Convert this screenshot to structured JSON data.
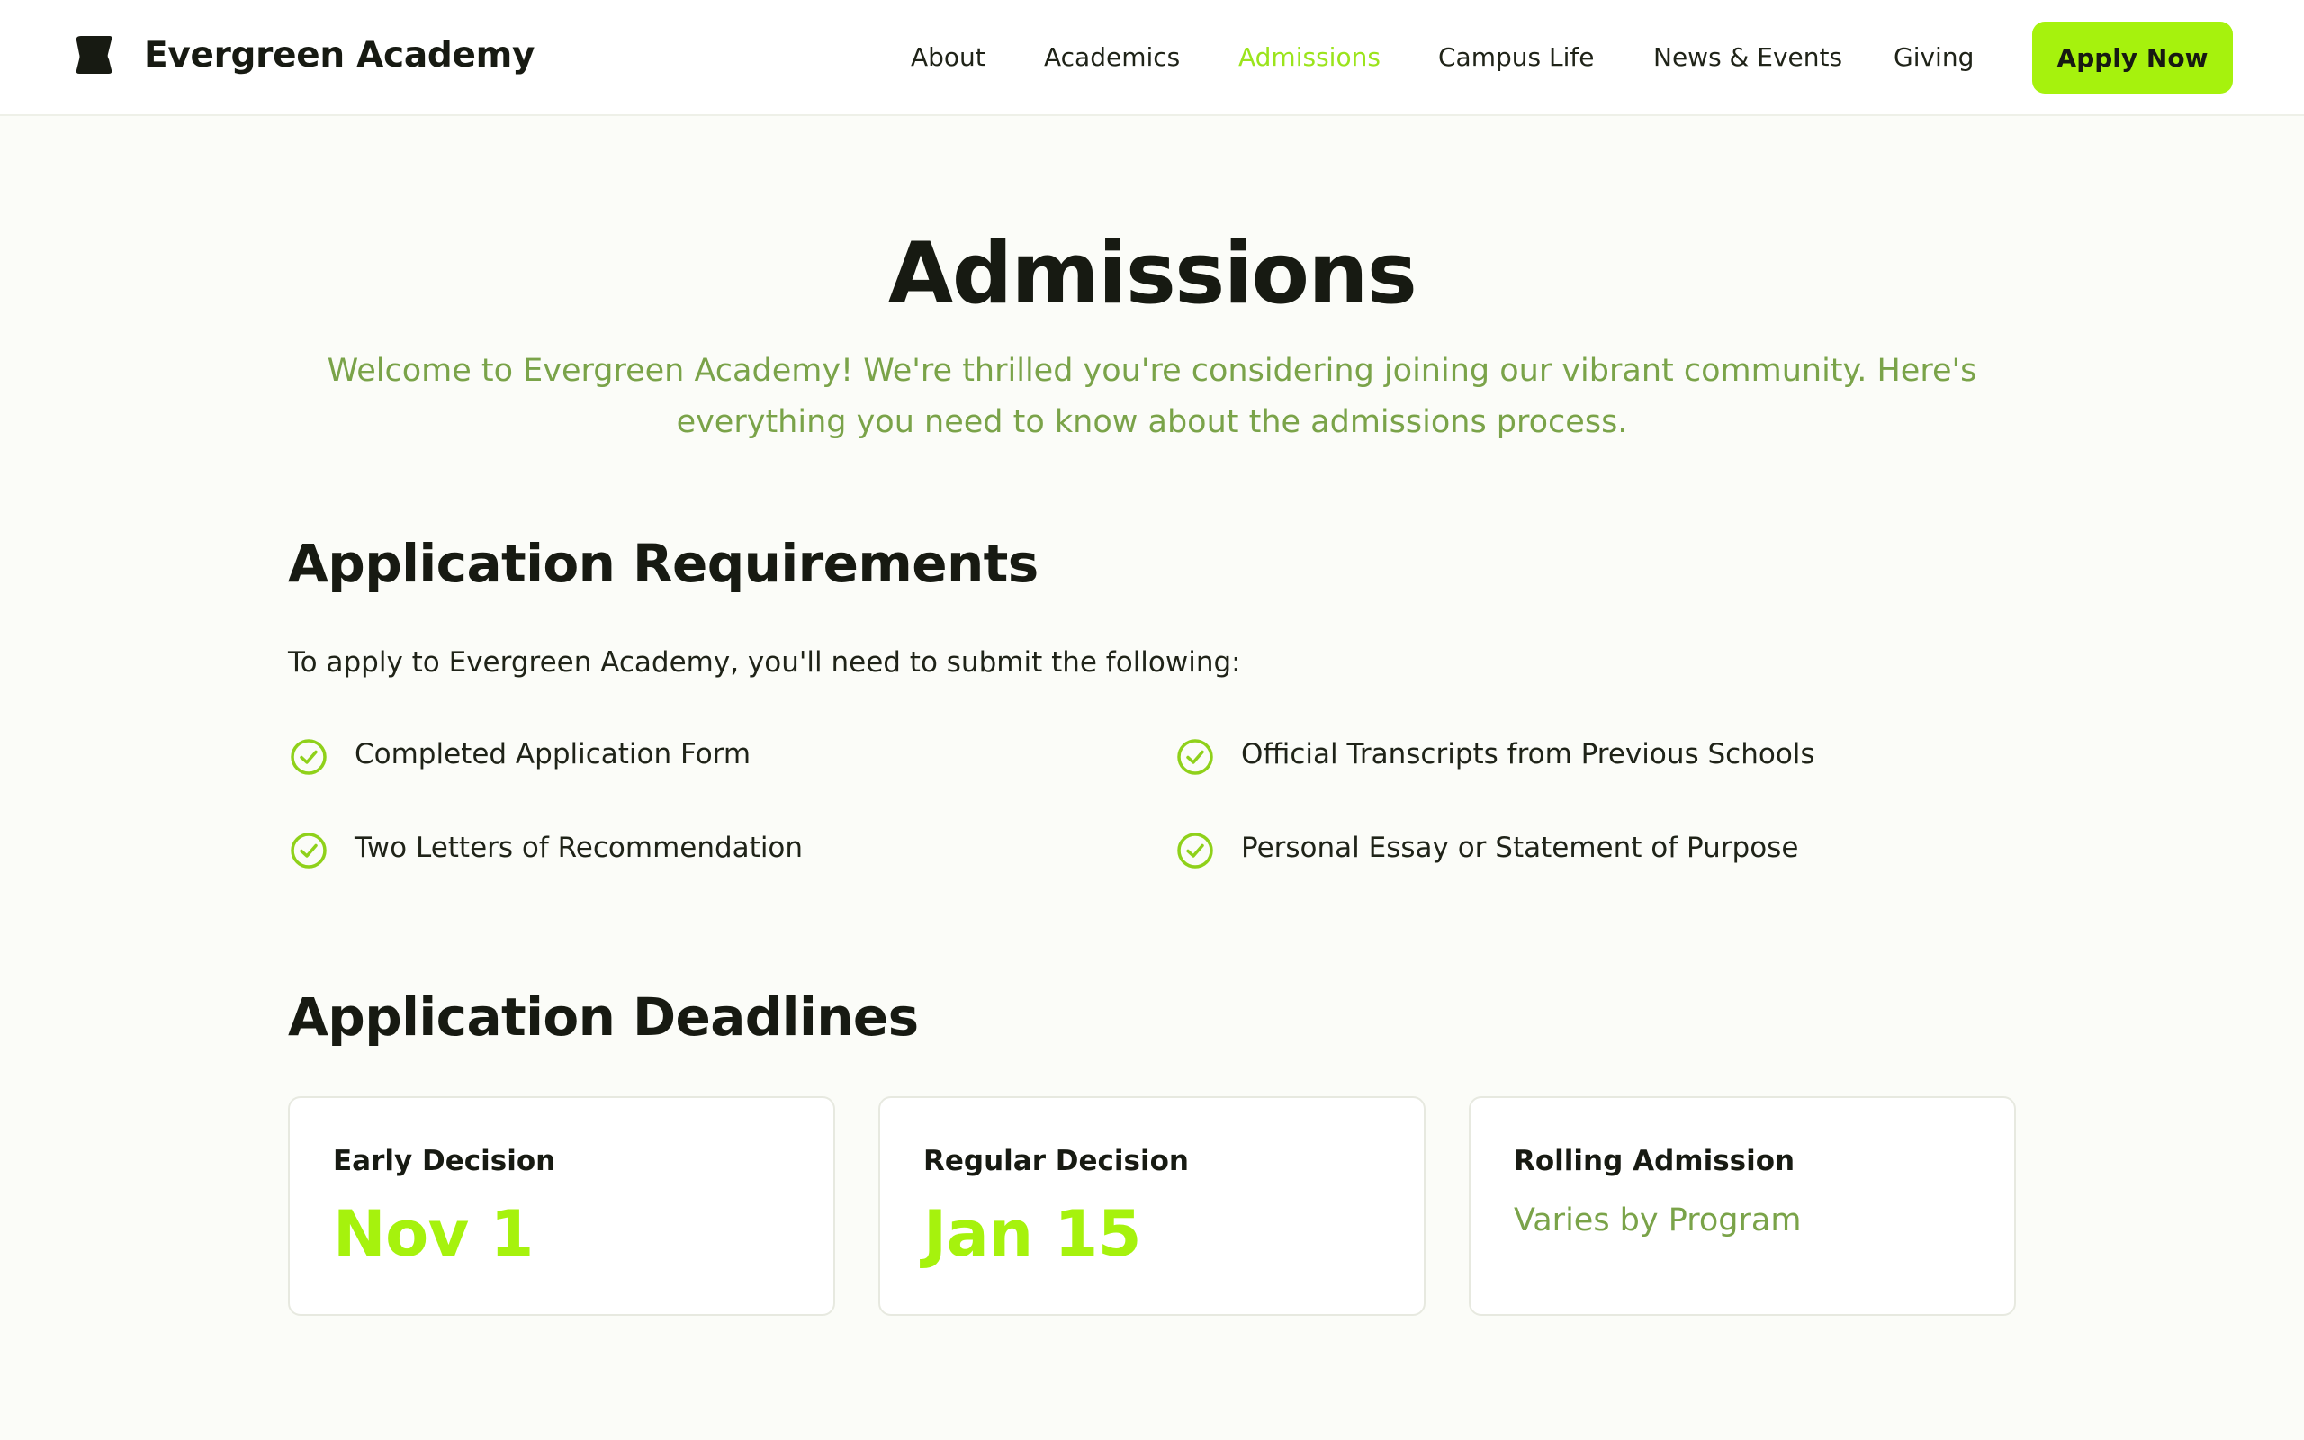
{
  "brand": {
    "name": "Evergreen Academy",
    "logo_icon": "leaf-block-logo"
  },
  "nav": {
    "items": [
      {
        "label": "About",
        "active": false
      },
      {
        "label": "Academics",
        "active": false
      },
      {
        "label": "Admissions",
        "active": true
      },
      {
        "label": "Campus Life",
        "active": false
      },
      {
        "label": "News & Events",
        "active": false
      },
      {
        "label": "Giving",
        "active": false
      }
    ],
    "cta_label": "Apply Now"
  },
  "hero": {
    "title": "Admissions",
    "intro": "Welcome to Evergreen Academy! We're thrilled you're considering joining our vibrant community. Here's everything you need to know about the admissions process."
  },
  "requirements": {
    "title": "Application Requirements",
    "lead": "To apply to Evergreen Academy, you'll need to submit the following:",
    "items": [
      "Completed Application Form",
      "Official Transcripts from Previous Schools",
      "Two Letters of Recommendation",
      "Personal Essay or Statement of Purpose"
    ],
    "icon": "check-circle-icon"
  },
  "deadlines": {
    "title": "Application Deadlines",
    "cards": [
      {
        "title": "Early Decision",
        "value": "Nov 1"
      },
      {
        "title": "Regular Decision",
        "value": "Jan 15"
      },
      {
        "title": "Rolling Admission",
        "value": "Varies by Program"
      }
    ]
  },
  "colors": {
    "accent": "#a6f20d",
    "accent_text": "#9be41c",
    "muted_green": "#7aa349",
    "text": "#171a12",
    "background": "#fbfcf8"
  }
}
